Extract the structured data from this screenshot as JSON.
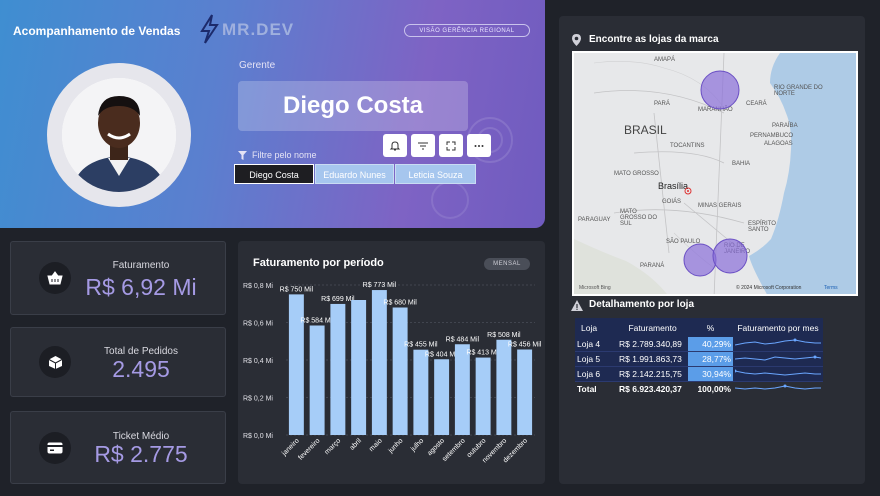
{
  "header": {
    "title": "Acompanhamento de Vendas",
    "logo_text": "MR.DEV",
    "view_badge": "VISÃO GERÊNCIA REGIONAL"
  },
  "manager": {
    "label": "Gerente",
    "name": "Diego Costa",
    "filter_label": "Filtre pelo nome",
    "slicer": [
      "Diego Costa",
      "Eduardo Nunes",
      "Leticia Souza"
    ],
    "selected": "Diego Costa"
  },
  "kpis": {
    "faturamento": {
      "label": "Faturamento",
      "value": "R$ 6,92 Mi",
      "icon": "basket-icon"
    },
    "pedidos": {
      "label": "Total de Pedidos",
      "value": "2.495",
      "icon": "box-icon"
    },
    "ticket": {
      "label": "Ticket Médio",
      "value": "R$ 2.775",
      "icon": "card-icon"
    }
  },
  "chart": {
    "title": "Faturamento por período",
    "period_badge": "MENSAL"
  },
  "chart_data": {
    "type": "bar",
    "title": "Faturamento por período",
    "categories": [
      "janeiro",
      "fevereiro",
      "março",
      "abril",
      "maio",
      "junho",
      "julho",
      "agosto",
      "setembro",
      "outubro",
      "novembro",
      "dezembro"
    ],
    "values": [
      750,
      584,
      699,
      720,
      773,
      680,
      455,
      404,
      484,
      413,
      508,
      456
    ],
    "data_labels": [
      "R$ 750 Mil",
      "R$ 584 Mil",
      "R$ 699 Mil",
      "",
      "R$ 773 Mil",
      "R$ 680 Mil",
      "R$ 455 Mil",
      "R$ 404 Mil",
      "R$ 484 Mil",
      "R$ 413 Mil",
      "R$ 508 Mil",
      "R$ 456 Mil"
    ],
    "y_ticks": [
      "R$ 0,0 Mi",
      "R$ 0,2 Mi",
      "R$ 0,4 Mi",
      "R$ 0,6 Mi",
      "R$ 0,8 Mi"
    ],
    "ylim": [
      0,
      800
    ],
    "bar_color": "#a6cdf8",
    "grid": true
  },
  "map": {
    "title": "Encontre as lojas da marca",
    "labels": {
      "amapa": "AMAPÁ",
      "para": "PARÁ",
      "maranhao": "MARANHÃO",
      "ceara": "CEARÁ",
      "rn": "RIO GRANDE DO NORTE",
      "paraiba": "PARAÍBA",
      "pernambuco": "PERNAMBUCO",
      "alagoas": "ALAGOAS",
      "brasil": "BRASIL",
      "tocantins": "TOCANTINS",
      "bahia": "BAHIA",
      "mato_grosso": "MATO GROSSO",
      "brasilia": "Brasília",
      "goias": "GOIÁS",
      "mgs": "MATO GROSSO DO SUL",
      "minas": "MINAS GERAIS",
      "sao_paulo": "SÃO PAULO",
      "rio": "RIO DE JANEIRO",
      "parana": "PARANÁ",
      "es": "ESPÍRITO SANTO",
      "paraguay": "PARAGUAY"
    },
    "copyright": "© 2024 Microsoft Corporation",
    "terms": "Terms",
    "bing": "Microsoft Bing"
  },
  "detail": {
    "title": "Detalhamento por loja",
    "headers": [
      "Loja",
      "Faturamento",
      "%",
      "Faturamento por mes"
    ],
    "rows": [
      {
        "loja": "Loja 4",
        "faturamento": "R$ 2.789.340,89",
        "pct": "40,29%",
        "pct_value": 40.29
      },
      {
        "loja": "Loja 5",
        "faturamento": "R$ 1.991.863,73",
        "pct": "28,77%",
        "pct_value": 28.77
      },
      {
        "loja": "Loja 6",
        "faturamento": "R$ 2.142.215,75",
        "pct": "30,94%",
        "pct_value": 30.94
      }
    ],
    "total": {
      "loja": "Total",
      "faturamento": "R$ 6.923.420,37",
      "pct": "100,00%"
    }
  },
  "colors": {
    "accent": "#a59ae4",
    "bar": "#a6cdf8",
    "table_bg": "#1e2a52",
    "pct_bar": "#5b9de8",
    "store_marker": "#8a6fd8"
  }
}
